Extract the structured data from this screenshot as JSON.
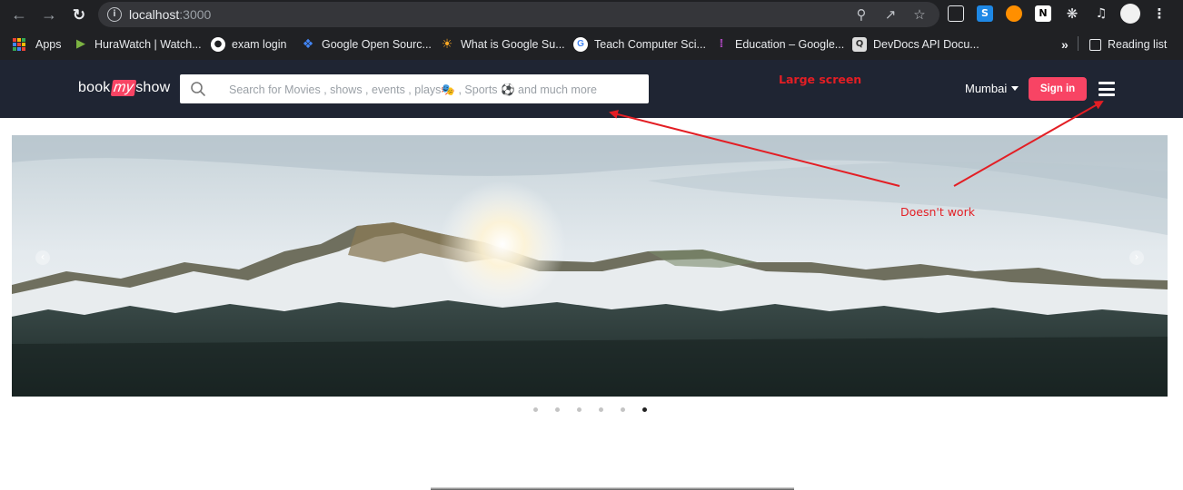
{
  "browser": {
    "url_host": "localhost",
    "url_port": ":3000",
    "nav_icons": [
      "back-arrow-icon",
      "forward-arrow-icon",
      "reload-icon"
    ],
    "omnibox_icons": [
      "zoom-icon",
      "share-icon",
      "star-icon"
    ],
    "extensions": [
      "tab-search-icon",
      "s-extension-icon",
      "mascot-extension-icon",
      "notion-icon",
      "puzzle-icon",
      "media-control-icon",
      "profile-avatar",
      "kebab-menu-icon"
    ]
  },
  "bookmarks": {
    "items": [
      {
        "label": "Apps",
        "icon": "apps-grid-icon"
      },
      {
        "label": "HuraWatch | Watch...",
        "icon": "play-icon",
        "color": "#7cb342"
      },
      {
        "label": "exam login",
        "icon": "globe-icon",
        "color": "#ffffff"
      },
      {
        "label": "Google Open Sourc...",
        "icon": "google-os-icon",
        "color": "#4285f4"
      },
      {
        "label": "What is Google Su...",
        "icon": "sun-icon",
        "color": "#f9a825"
      },
      {
        "label": "Teach Computer Sci...",
        "icon": "google-g-icon",
        "color": "#ffffff"
      },
      {
        "label": "Education – Google...",
        "icon": "dots-grid-icon",
        "color": "#8e24aa"
      },
      {
        "label": "DevDocs API Docu...",
        "icon": "devdocs-icon",
        "color": "#dddddd"
      }
    ],
    "overflow": "»",
    "reading_list": "Reading list"
  },
  "site": {
    "logo": {
      "pre": "book",
      "mid": "my",
      "post": "show"
    },
    "search_placeholder": "Search for Movies , shows , events , plays🎭 , Sports ⚽ and much more",
    "city": "Mumbai",
    "signin_label": "Sign in",
    "brand_color": "#f84464",
    "header_color": "#1f2533"
  },
  "carousel": {
    "arrow_left": "‹",
    "arrow_right": "›",
    "slide_count": 6,
    "active_slide": 6
  },
  "annotations": {
    "large_screen": "Large screen",
    "doesnt_work": "Doesn't work",
    "color": "#e31e24"
  }
}
